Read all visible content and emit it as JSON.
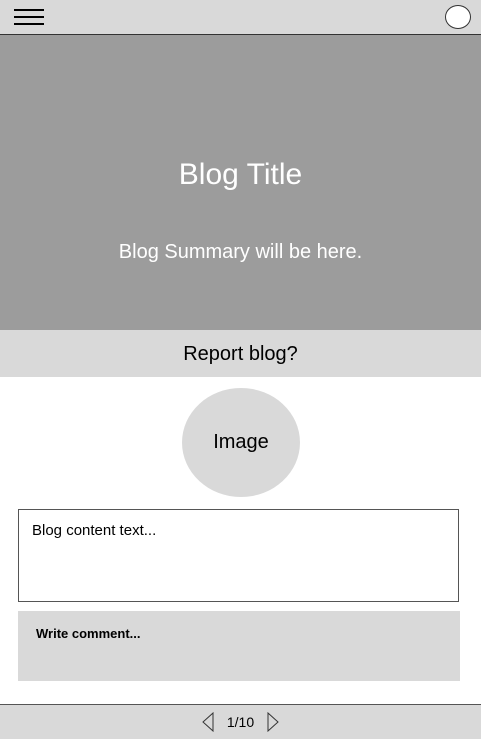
{
  "header": {
    "menu_icon": "hamburger-icon",
    "profile_icon": "circle-avatar-icon"
  },
  "hero": {
    "title": "Blog Title",
    "summary": "Blog Summary will be here."
  },
  "report_label": "Report blog?",
  "image_placeholder": "Image",
  "content_text": "Blog content text...",
  "comment_placeholder": "Write comment...",
  "pagination": {
    "label": "1/10",
    "current": 1,
    "total": 10
  }
}
